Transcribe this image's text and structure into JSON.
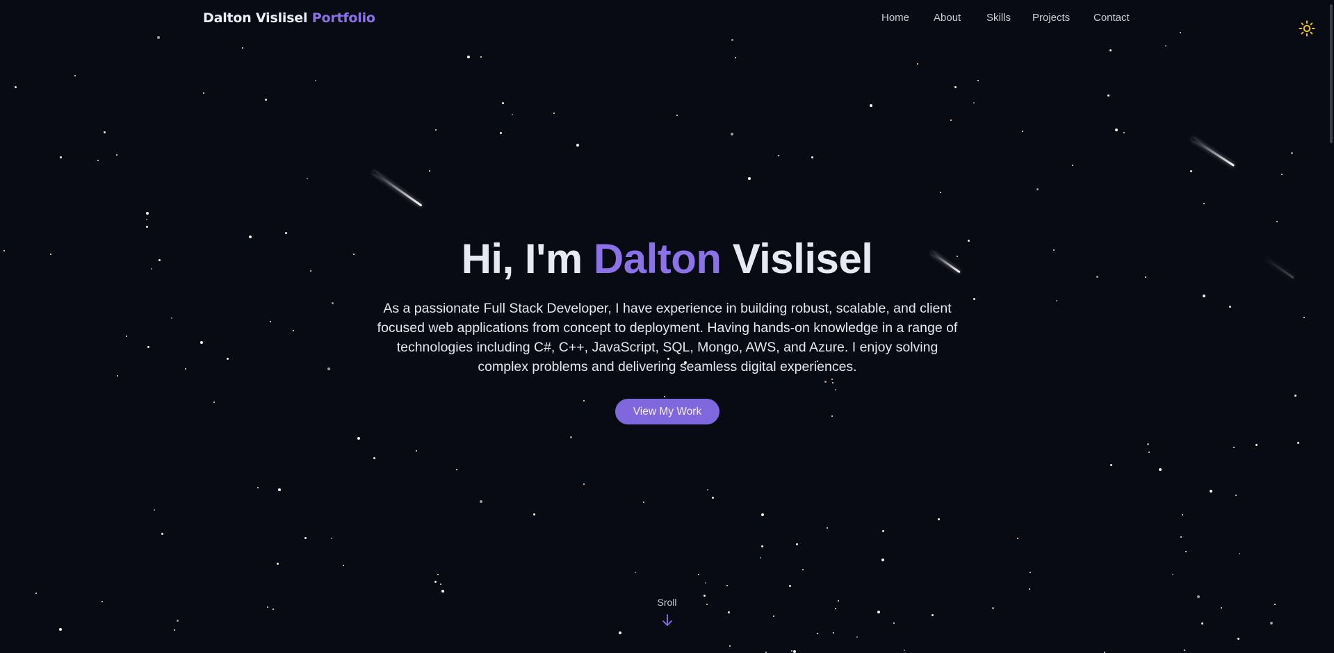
{
  "navbar": {
    "brand_name": "Dalton Vislisel",
    "brand_suffix": "Portfolio",
    "links": [
      {
        "label": "Home"
      },
      {
        "label": "About"
      },
      {
        "label": "Skills"
      },
      {
        "label": "Projects"
      },
      {
        "label": "Contact"
      }
    ],
    "theme_toggle_icon": "sun-icon"
  },
  "hero": {
    "greeting": "Hi, I'm",
    "first_name": "Dalton",
    "last_name": "Vislisel",
    "description": "As a passionate Full Stack Developer, I have experience in building robust, scalable, and client focused web applications from concept to deployment. Having hands-on knowledge in a range of technologies including C#, C++, JavaScript, SQL, Mongo, AWS, and Azure. I enjoy solving complex problems and delivering seamless digital experiences.",
    "cta_label": "View My Work"
  },
  "scroll": {
    "label": "Sroll",
    "icon": "arrow-down-icon"
  },
  "colors": {
    "background": "#090b13",
    "accent": "#8b72e8",
    "button": "#7f68de",
    "text": "#e8eaf2",
    "sun": "#f5c518"
  }
}
